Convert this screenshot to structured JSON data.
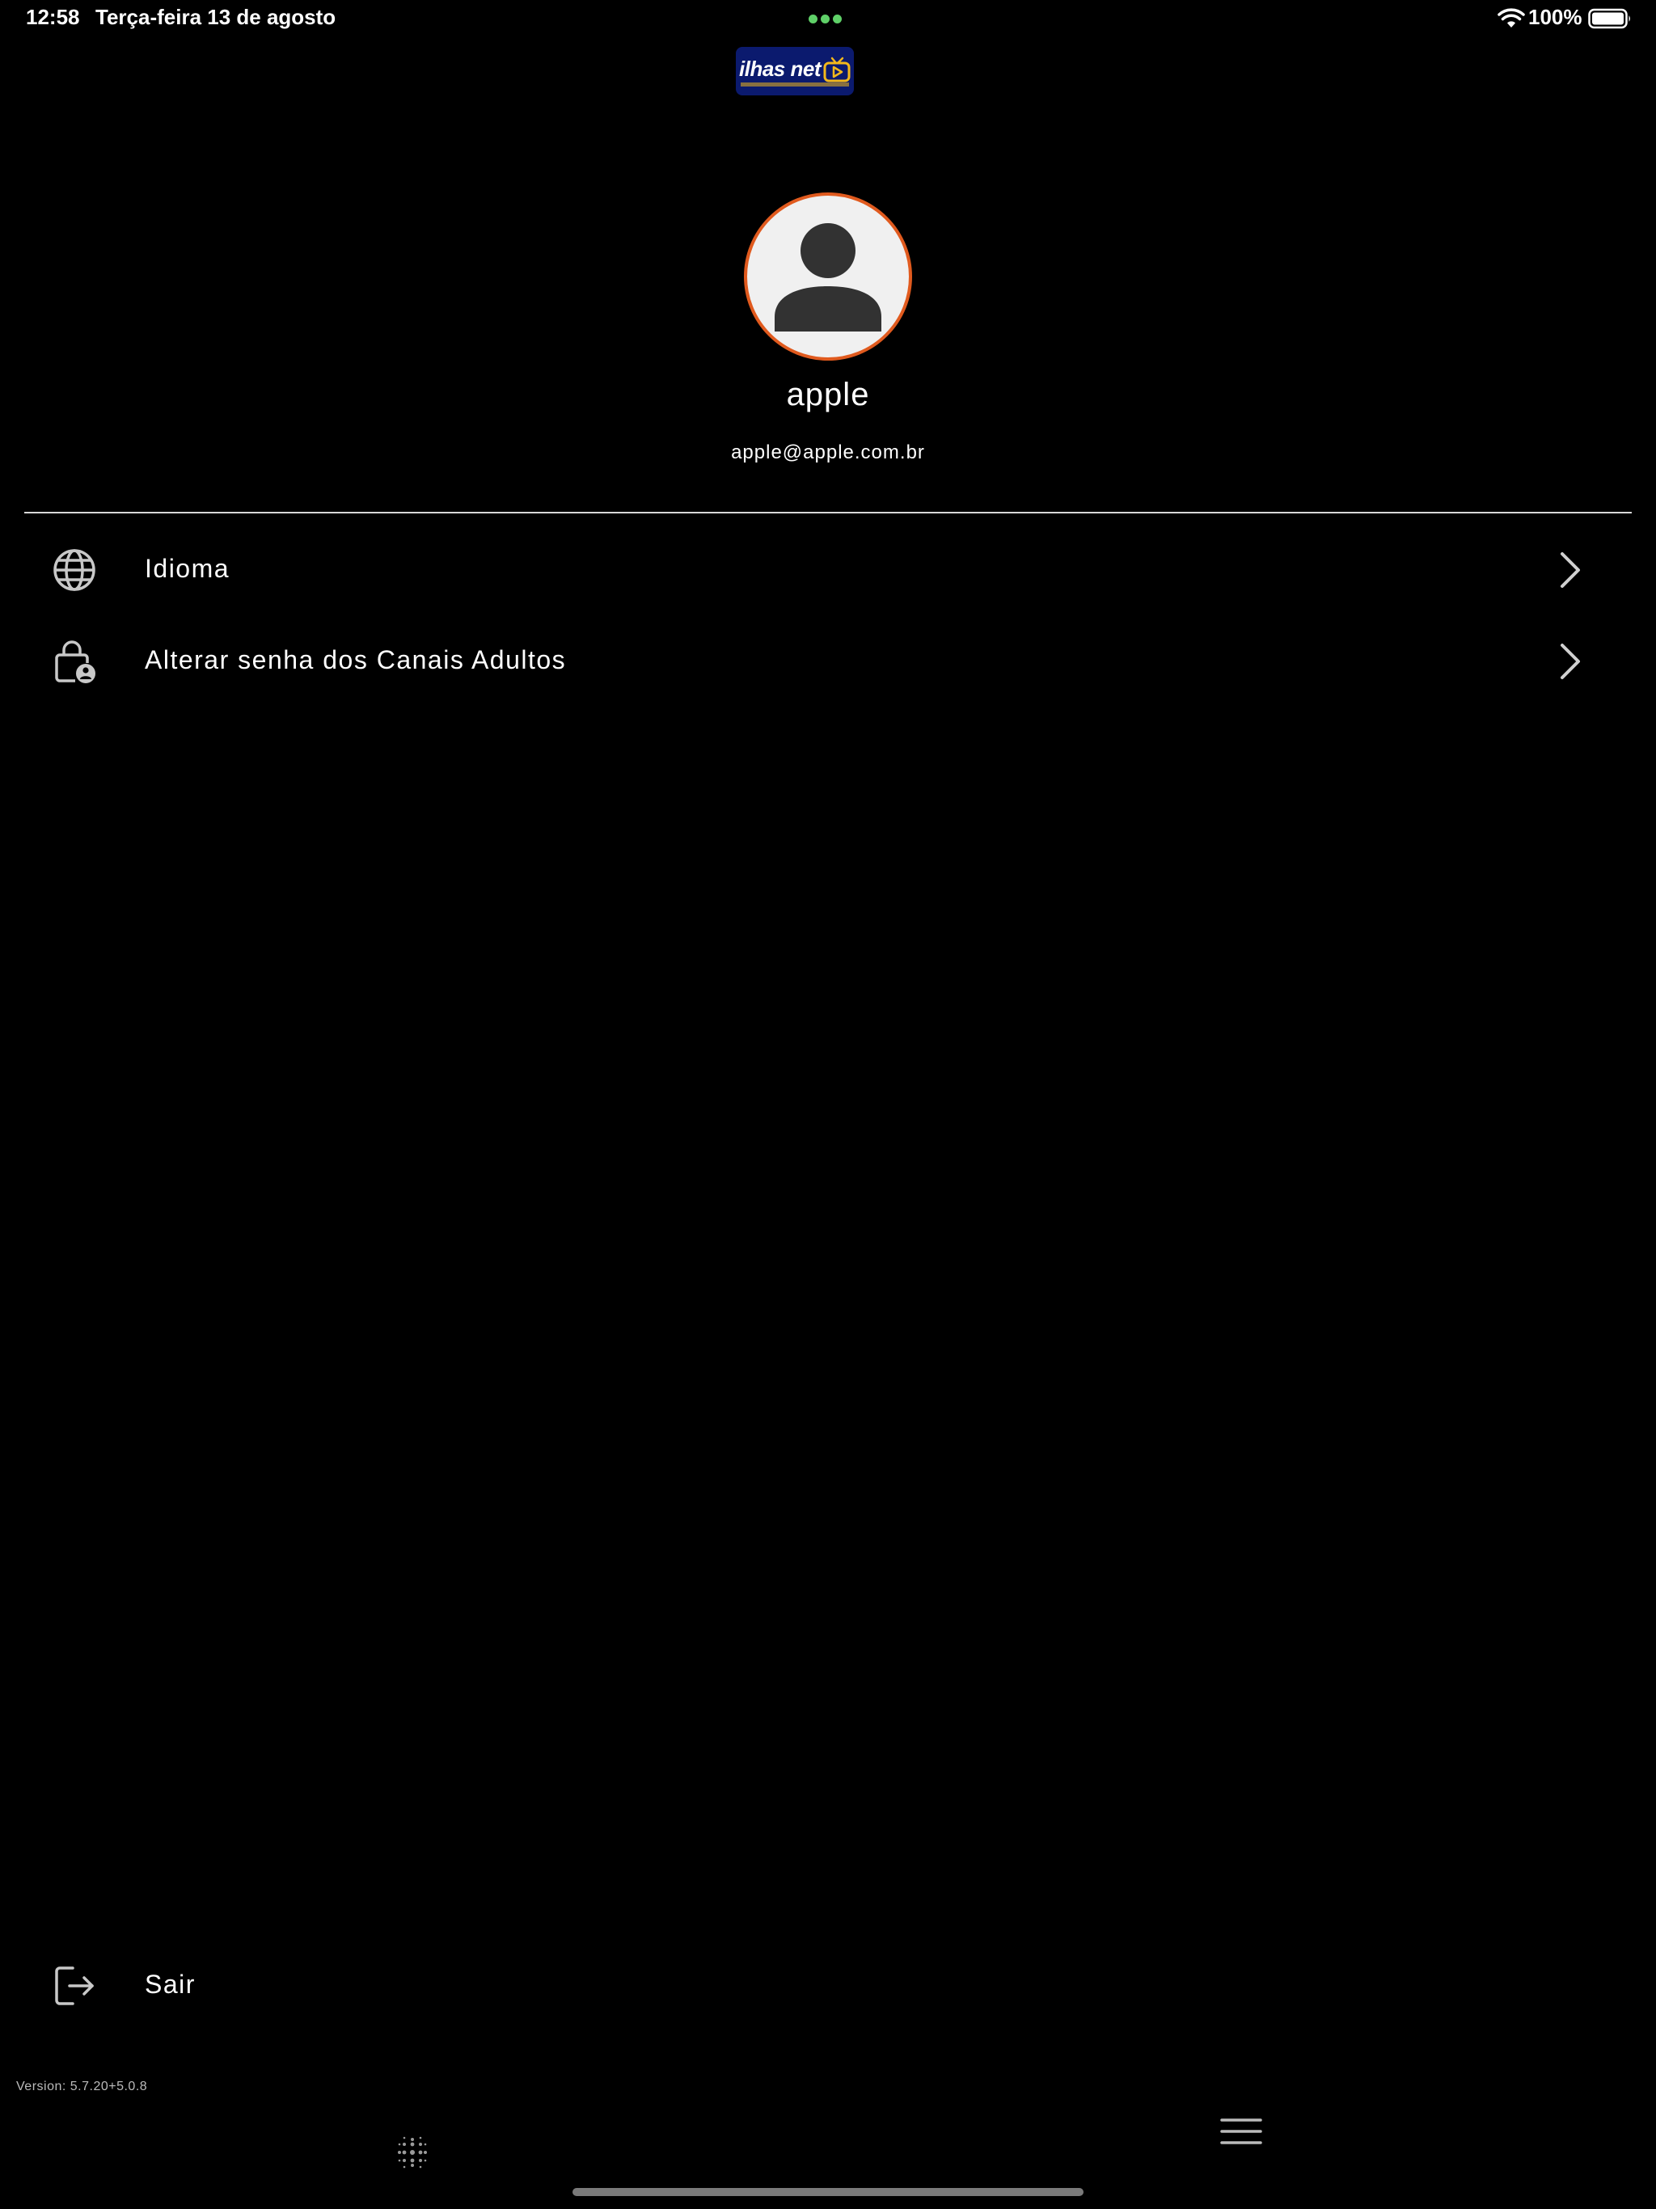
{
  "status_bar": {
    "time": "12:58",
    "date": "Terça-feira 13 de agosto",
    "battery": "100%",
    "icons": [
      "wifi-icon",
      "battery-icon"
    ],
    "dots_color": "#5fd068"
  },
  "logo": {
    "text": "ilhas net",
    "background": "#0b1a6e",
    "accent": "#f3b81b"
  },
  "profile": {
    "name": "apple",
    "email": "apple@apple.com.br",
    "avatar_icon": "person-icon",
    "avatar_border": "#e05a1e"
  },
  "menu": {
    "items": [
      {
        "label": "Idioma",
        "icon": "globe-icon"
      },
      {
        "label": "Alterar senha dos Canais Adultos",
        "icon": "lock-person-icon"
      }
    ]
  },
  "logout": {
    "label": "Sair",
    "icon": "logout-icon"
  },
  "footer": {
    "version": "Version: 5.7.20+5.0.8",
    "icons": [
      "dots-grid-icon",
      "hamburger-menu-icon"
    ],
    "home_indicator_color": "#7a7a7a"
  },
  "theme": {
    "background": "#000000",
    "text": "#ffffff",
    "icon_color": "#c8c8c8"
  }
}
